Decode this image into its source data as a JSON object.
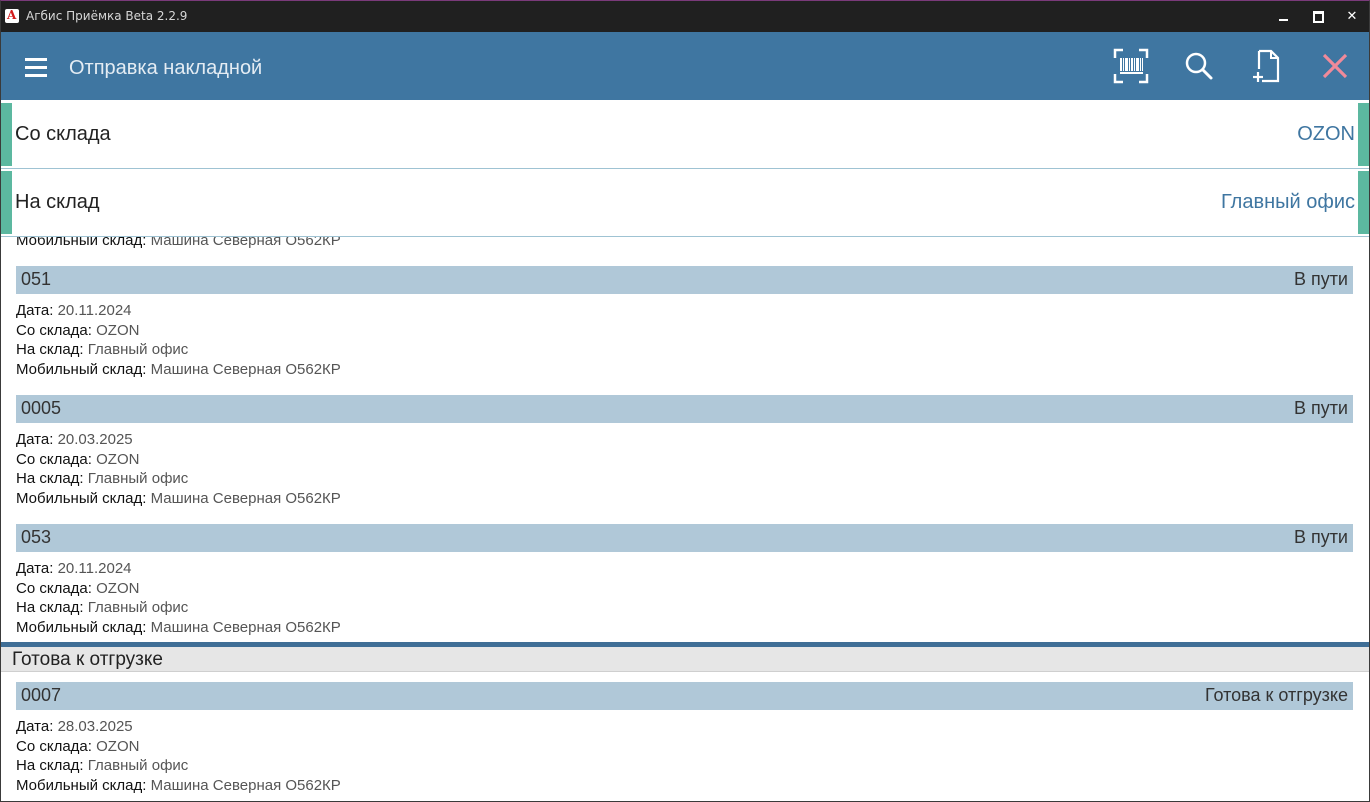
{
  "window": {
    "title": "Агбис Приёмка Beta 2.2.9",
    "logo_letter": "A",
    "controls": {
      "minimize": "minimize",
      "maximize": "maximize",
      "close": "✕"
    }
  },
  "appbar": {
    "title": "Отправка накладной",
    "icons": [
      "menu-icon",
      "barcode-scan-icon",
      "search-icon",
      "new-document-icon",
      "close-icon"
    ],
    "accent": "#3f76a1",
    "close_color": "#f08a9a"
  },
  "filters": {
    "from": {
      "label": "Со склада",
      "value": "OZON"
    },
    "to": {
      "label": "На склад",
      "value": "Главный офис"
    }
  },
  "field_labels": {
    "date": "Дата:",
    "from": "Со склада:",
    "to": "На склад:",
    "mobile": "Мобильный склад:"
  },
  "partial_row": {
    "mobile_label": "Мобильный склад:",
    "mobile_value": "Машина Северная О562КР"
  },
  "documents": [
    {
      "number": "051",
      "status": "В пути",
      "date": "20.11.2024",
      "from": "OZON",
      "to": "Главный офис",
      "mobile": "Машина Северная О562КР"
    },
    {
      "number": "0005",
      "status": "В пути",
      "date": "20.03.2025",
      "from": "OZON",
      "to": "Главный офис",
      "mobile": "Машина Северная О562КР"
    },
    {
      "number": "053",
      "status": "В пути",
      "date": "20.11.2024",
      "from": "OZON",
      "to": "Главный офис",
      "mobile": "Машина Северная О562КР"
    }
  ],
  "section": {
    "title": "Готова к отгрузке",
    "documents": [
      {
        "number": "0007",
        "status": "Готова к отгрузке",
        "date": "28.03.2025",
        "from": "OZON",
        "to": "Главный офис",
        "mobile": "Машина Северная О562КР"
      }
    ]
  }
}
